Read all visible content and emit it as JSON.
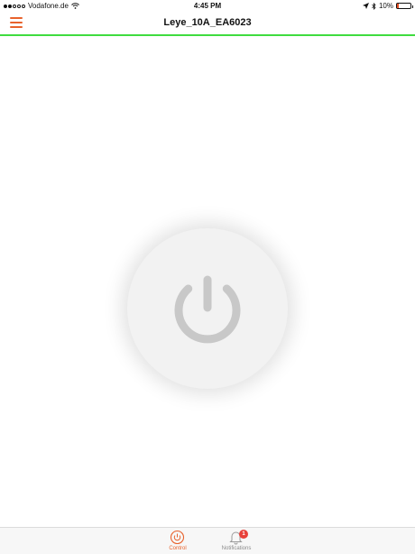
{
  "status_bar": {
    "carrier": "Vodafone.de",
    "time": "4:45 PM",
    "battery_percent": "10%",
    "battery_level": 0.1,
    "icons": [
      "signal-dots-icon",
      "wifi-icon",
      "location-arrow-icon",
      "bluetooth-icon",
      "battery-icon"
    ]
  },
  "nav": {
    "title": "Leye_10A_EA6023",
    "menu_icon": "hamburger-menu-icon"
  },
  "colors": {
    "accent": "#e8622c",
    "progress_line": "#3fdc3f",
    "badge": "#e8413a",
    "power_icon": "#c8c8c8"
  },
  "main": {
    "power_button_icon": "power-icon"
  },
  "tab_bar": {
    "tabs": [
      {
        "label": "Control",
        "icon": "control-icon",
        "active": true
      },
      {
        "label": "Notifications",
        "icon": "bell-icon",
        "active": false,
        "badge": "1"
      }
    ]
  }
}
